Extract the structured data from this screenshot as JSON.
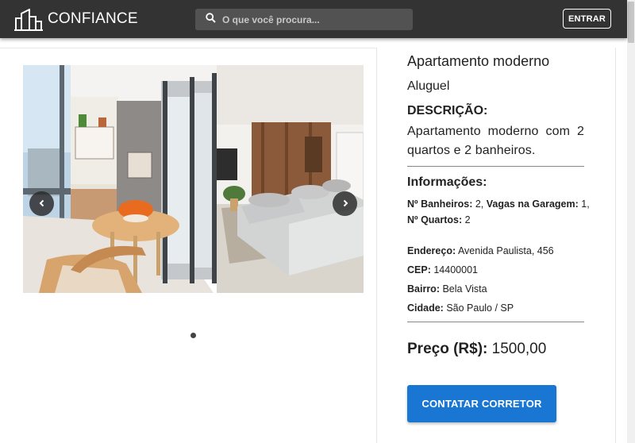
{
  "header": {
    "brand": "CONFIANCE",
    "search_placeholder": "O que você procura...",
    "login_label": "ENTRAR"
  },
  "carousel": {
    "slide_count": 1,
    "active_index": 0
  },
  "property": {
    "title": "Apartamento moderno",
    "listing_type": "Aluguel",
    "description_heading": "DESCRIÇÃO:",
    "description": "Apartamento moderno com 2 quartos e 2 banheiros.",
    "info_heading": "Informações:",
    "bathrooms_label": "Nº Banheiros:",
    "bathrooms_value": "2",
    "parking_label": "Vagas na Garagem:",
    "parking_value": "1",
    "rooms_label": "Nº Quartos:",
    "rooms_value": "2",
    "address_label": "Endereço:",
    "address_value": "Avenida Paulista, 456",
    "cep_label": "CEP:",
    "cep_value": "14400001",
    "neighborhood_label": "Bairro:",
    "neighborhood_value": "Bela Vista",
    "city_label": "Cidade:",
    "city_value": "São Paulo / SP",
    "price_label": "Preço (R$):",
    "price_value": "1500,00",
    "contact_label": "CONTATAR CORRETOR"
  },
  "colors": {
    "topbar": "#333333",
    "search_bg": "#525252",
    "primary_button": "#1976d2"
  },
  "icons": {
    "logo": "buildings-logo-icon",
    "search": "search-icon",
    "prev": "chevron-left-icon",
    "next": "chevron-right-icon"
  }
}
